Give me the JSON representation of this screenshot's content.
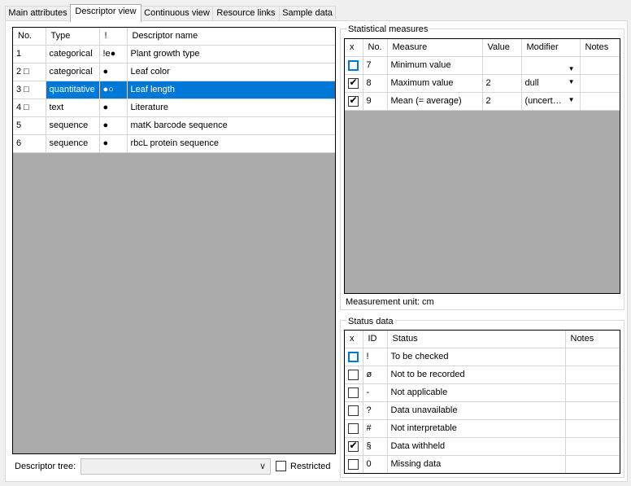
{
  "tabs": [
    "Main attributes",
    "Descriptor view",
    "Continuous view",
    "Resource links",
    "Sample data"
  ],
  "descriptors": {
    "headers": [
      "No.",
      "Type",
      "!",
      "Descriptor name"
    ],
    "rows": [
      {
        "no": "1",
        "type": "categorical",
        "flag": "!e●",
        "name": "Plant growth type"
      },
      {
        "no": "2 □",
        "type": "categorical",
        "flag": "●",
        "name": "Leaf color"
      },
      {
        "no": "3 □",
        "type": "quantitative",
        "flag": "●○",
        "name": "Leaf length"
      },
      {
        "no": "4 □",
        "type": "text",
        "flag": "●",
        "name": "Literature"
      },
      {
        "no": "5",
        "type": "sequence",
        "flag": "●",
        "name": "matK barcode sequence"
      },
      {
        "no": "6",
        "type": "sequence",
        "flag": "●",
        "name": "rbcL protein sequence"
      }
    ]
  },
  "descriptor_tree": {
    "label": "Descriptor tree:",
    "value": "",
    "restricted_label": "Restricted",
    "restricted_checked": false
  },
  "statistical": {
    "title": "Statistical measures",
    "headers": [
      "x",
      "No.",
      "Measure",
      "Value",
      "Modifier",
      "Notes"
    ],
    "rows": [
      {
        "checked": false,
        "no": "7",
        "measure": "Minimum value",
        "value": "",
        "modifier": "",
        "notes": ""
      },
      {
        "checked": true,
        "no": "8",
        "measure": "Maximum value",
        "value": "2",
        "modifier": "dull",
        "notes": ""
      },
      {
        "checked": true,
        "no": "9",
        "measure": "Mean (= average)",
        "value": "2",
        "modifier": "(uncert…",
        "notes": ""
      }
    ],
    "unit_label": "Measurement unit:",
    "unit_value": "cm"
  },
  "status": {
    "title": "Status data",
    "headers": [
      "x",
      "ID",
      "Status",
      "Notes"
    ],
    "rows": [
      {
        "checked": false,
        "id": "!",
        "status": "To be checked",
        "notes": ""
      },
      {
        "checked": false,
        "id": "ø",
        "status": "Not to be recorded",
        "notes": ""
      },
      {
        "checked": false,
        "id": "-",
        "status": "Not applicable",
        "notes": ""
      },
      {
        "checked": false,
        "id": "?",
        "status": "Data unavailable",
        "notes": ""
      },
      {
        "checked": false,
        "id": "#",
        "status": "Not interpretable",
        "notes": ""
      },
      {
        "checked": true,
        "id": "§",
        "status": "Data withheld",
        "notes": ""
      },
      {
        "checked": false,
        "id": "0",
        "status": "Missing data",
        "notes": ""
      }
    ]
  },
  "icons": {
    "check": "✔",
    "dropdown": "▼",
    "combo_arrow": "∨"
  }
}
